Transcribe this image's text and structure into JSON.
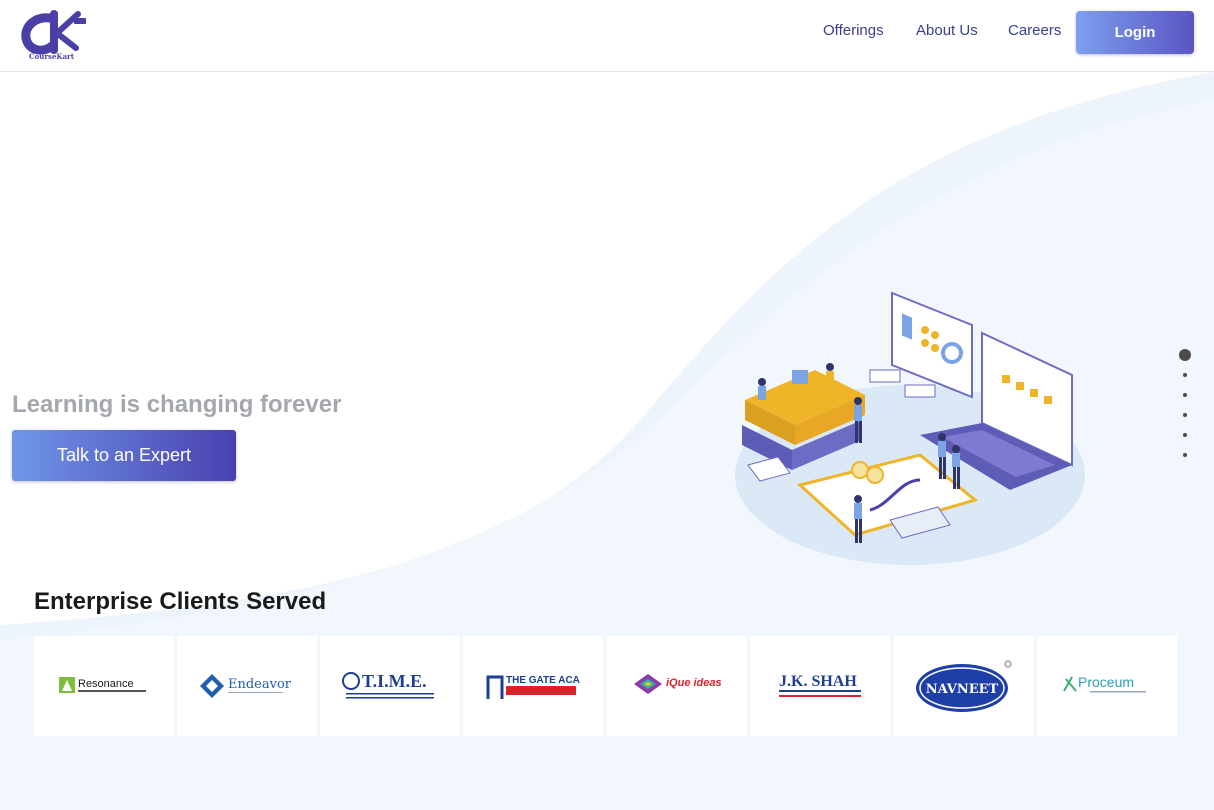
{
  "brand": {
    "name": "CourseKart",
    "logo_text": "CourseKart",
    "accent": "#4a3fa6"
  },
  "nav": {
    "items": [
      {
        "label": "Offerings"
      },
      {
        "label": "About Us"
      },
      {
        "label": "Careers"
      }
    ],
    "login_label": "Login"
  },
  "hero": {
    "title": "Learning is changing forever",
    "cta_label": "Talk to an Expert",
    "slider": {
      "total": 6,
      "active_index": 0
    }
  },
  "clients": {
    "title": "Enterprise Clients Served",
    "logos": [
      {
        "name": "Resonance",
        "icon": "resonance-logo"
      },
      {
        "name": "Endeavor",
        "icon": "endeavor-logo"
      },
      {
        "name": "T.I.M.E.",
        "icon": "time-logo"
      },
      {
        "name": "THE GATE ACADEMY",
        "icon": "gate-academy-logo"
      },
      {
        "name": "iQue ideas",
        "icon": "ique-logo"
      },
      {
        "name": "J.K. SHAH",
        "icon": "jkshah-logo"
      },
      {
        "name": "NAVNEET",
        "icon": "navneet-logo"
      },
      {
        "name": "Proceum",
        "icon": "proceum-logo"
      }
    ]
  },
  "colors": {
    "primary_gradient_start": "#7da0ee",
    "primary_gradient_end": "#4a40b0",
    "wave_background": "#eef4fc"
  }
}
